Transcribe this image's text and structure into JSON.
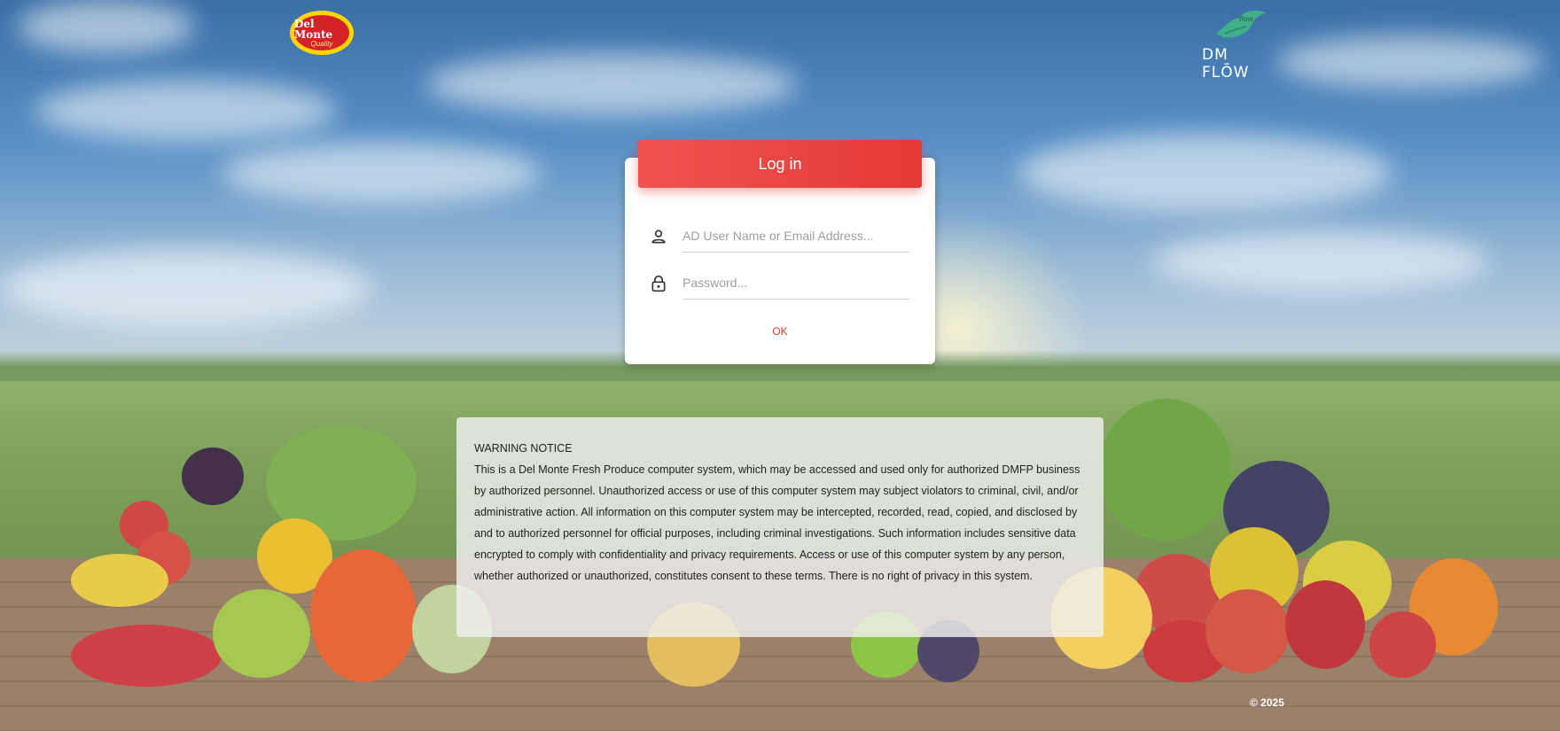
{
  "header": {
    "left_logo": {
      "brand": "Del Monte",
      "tagline": "Quality"
    },
    "right_logo": {
      "mark": "flow",
      "name": "DM FLŌW"
    }
  },
  "login": {
    "title": "Log in",
    "username_placeholder": "AD User Name or Email Address...",
    "password_placeholder": "Password...",
    "ok_label": "OK",
    "username_icon": "person-icon",
    "password_icon": "lock-icon",
    "accent_color": "#e53935"
  },
  "warning": {
    "title": "WARNING NOTICE",
    "body": "This is a Del Monte Fresh Produce computer system, which may be accessed and used only for authorized DMFP business by authorized personnel. Unauthorized access or use of this computer system may subject violators to criminal, civil, and/or administrative action. All information on this computer system may be intercepted, recorded, read, copied, and disclosed by and to authorized personnel for official purposes, including criminal investigations. Such information includes sensitive data encrypted to comply with confidentiality and privacy requirements. Access or use of this computer system by any person, whether authorized or unauthorized, constitutes consent to these terms. There is no right of privacy in this system."
  },
  "footer": {
    "copyright": "© 2025"
  }
}
